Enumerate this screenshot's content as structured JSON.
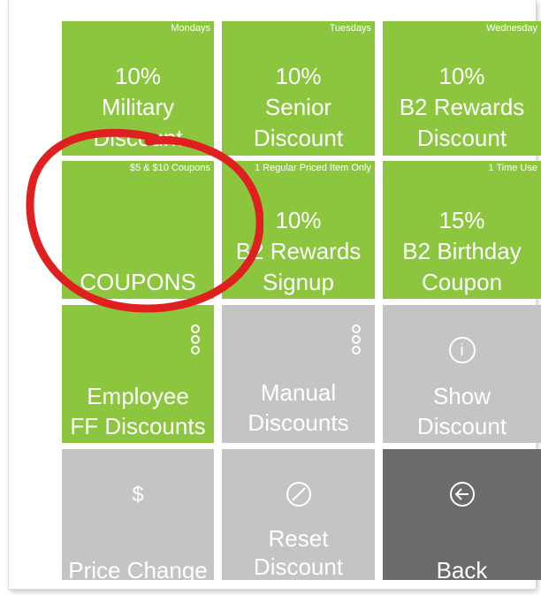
{
  "tiles": {
    "t1": {
      "tag": "Mondays",
      "line1": "10%",
      "line2": "Military",
      "line3": "Discount"
    },
    "t2": {
      "tag": "Tuesdays",
      "line1": "10%",
      "line2": "Senior",
      "line3": "Discount"
    },
    "t3": {
      "tag": "Wednesday",
      "line1": "10%",
      "line2": "B2 Rewards",
      "line3": "Discount"
    },
    "t4": {
      "tag": "$5 & $10 Coupons",
      "line1": "COUPONS"
    },
    "t5": {
      "tag": "1 Regular Priced Item Only",
      "line1": "10%",
      "line2": "B2 Rewards",
      "line3": "Signup"
    },
    "t6": {
      "tag": "1 Time Use",
      "line1": "15%",
      "line2": "B2 Birthday",
      "line3": "Coupon"
    },
    "t7": {
      "line1": "Employee",
      "line2": "FF Discounts",
      "icon": "more-icon"
    },
    "t8": {
      "line1": "Manual",
      "line2": "Discounts",
      "icon": "more-icon"
    },
    "t9": {
      "line1": "Show",
      "line2": "Discount",
      "icon": "info-icon",
      "icon_glyph": "i"
    },
    "t10": {
      "line1": "Price Change",
      "icon": "dollar-icon",
      "icon_glyph": "$"
    },
    "t11": {
      "line1": "Reset",
      "line2": "Discount",
      "icon": "no-icon"
    },
    "t12": {
      "line1": "Back",
      "icon": "back-arrow-icon"
    }
  },
  "colors": {
    "green": "#8cc63f",
    "gray": "#c4c4c4",
    "dark": "#6b6b6b",
    "annotation": "#e02020"
  }
}
